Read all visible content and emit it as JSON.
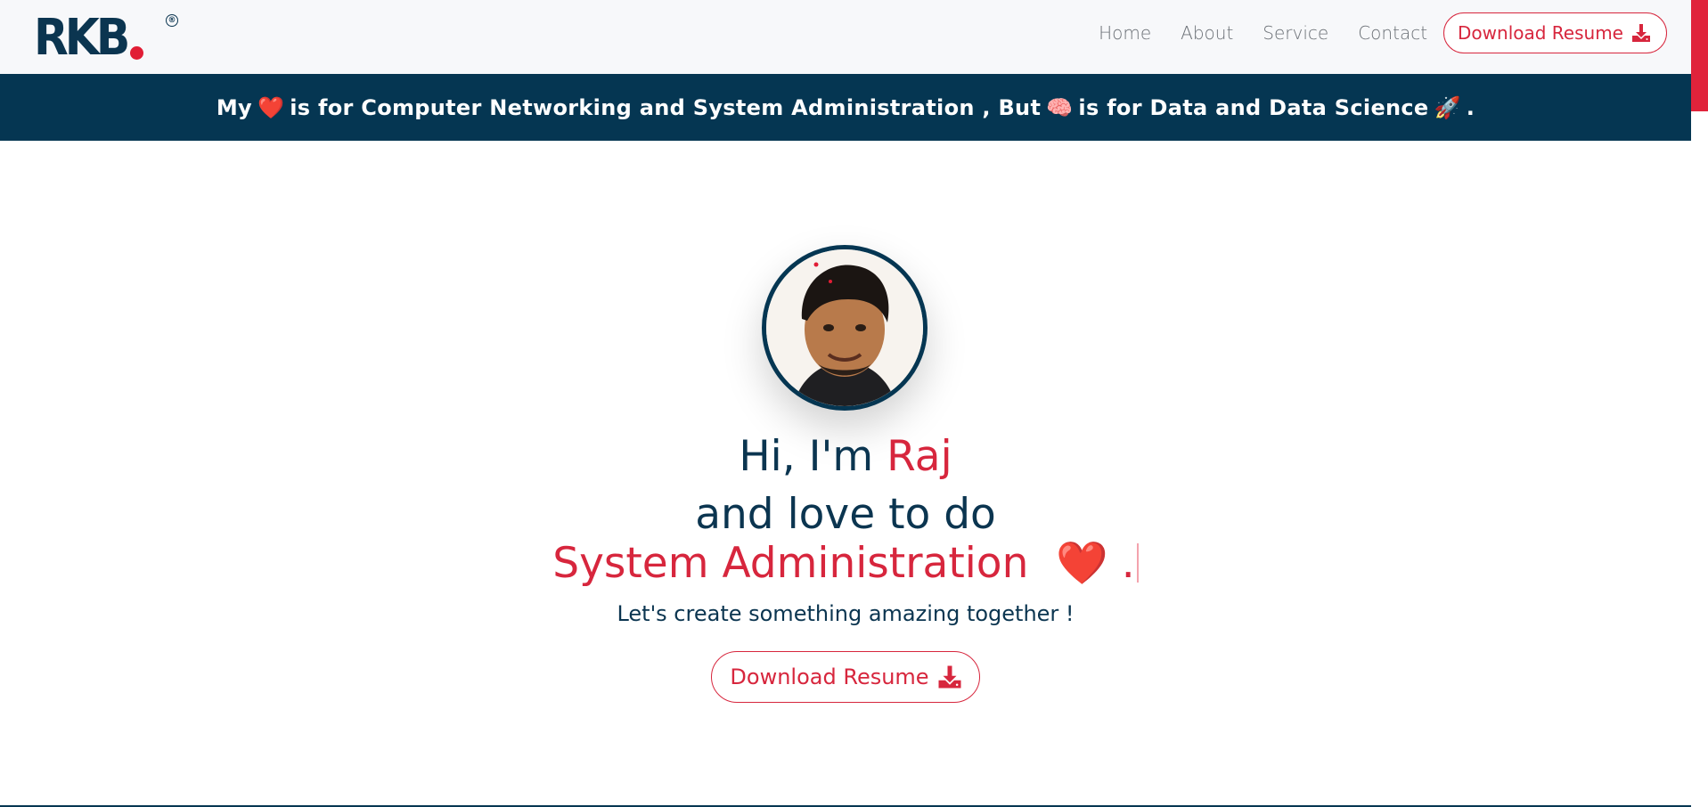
{
  "header": {
    "logo_text": "RKB",
    "logo_mark": "®",
    "nav": [
      "Home",
      "About",
      "Service",
      "Contact"
    ],
    "download_label": "Download Resume",
    "download_icon": "download-icon"
  },
  "banner": {
    "part1": "My",
    "heart": "❤️",
    "part2": "is for Computer Networking and System Administration , But",
    "brain": "🧠",
    "part3": "is for Data and Data Science",
    "rocket": "🚀",
    "end": "."
  },
  "hero": {
    "greeting_prefix": "Hi, I'm",
    "name": "Raj",
    "line2": "and love to do",
    "typed_text": "System Administration",
    "typed_emoji": "❤️",
    "typed_end": ".",
    "tagline": "Let's create something amazing together !",
    "button_label": "Download Resume"
  },
  "colors": {
    "navy": "#053652",
    "accent": "#d7263d"
  }
}
